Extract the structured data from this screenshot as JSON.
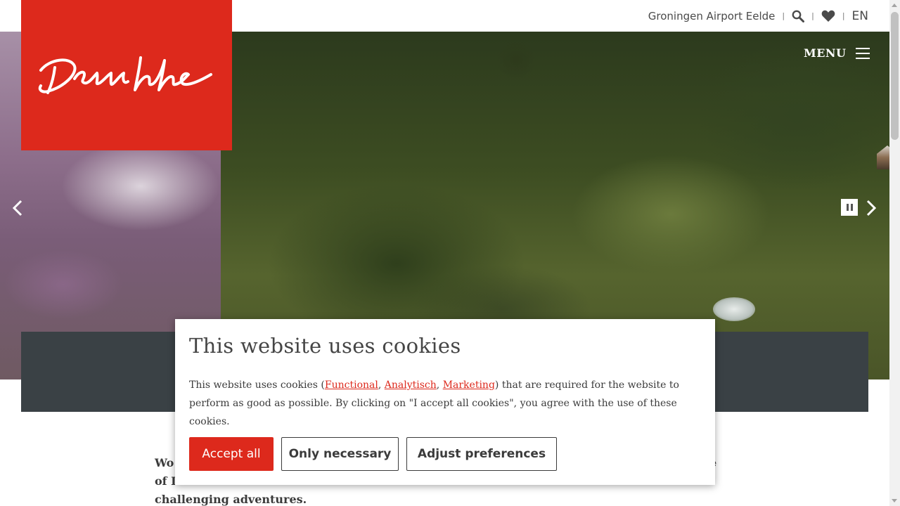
{
  "header": {
    "airport_link": "Groningen Airport Eelde",
    "language": "EN",
    "separator": "|"
  },
  "logo": {
    "text": "Drenthe",
    "color": "#dd291c"
  },
  "menu": {
    "label": "MENU"
  },
  "icons": {
    "search": "search-icon",
    "favorites": "heart-icon",
    "menu": "hamburger-icon",
    "prev": "chevron-left-icon",
    "next": "chevron-right-icon",
    "pause": "pause-icon"
  },
  "intro": {
    "line1_start": "Wo",
    "line1_end": "e",
    "line2_start": "of D",
    "line3": "challenging adventures."
  },
  "cookie": {
    "title": "This website uses cookies",
    "text_before": "This website uses cookies (",
    "link_functional": "Functional",
    "comma1": ", ",
    "link_analytics": "Analytisch",
    "comma2": ", ",
    "link_marketing": "Marketing",
    "text_after": ") that are required for the website to perform as good as possible. By clicking on \"I accept all cookies\", you agree with the use of these cookies.",
    "accept_label": "Accept all",
    "necessary_label": "Only necessary",
    "adjust_label": "Adjust preferences"
  },
  "colors": {
    "accent": "#dd291c",
    "dark_band": "#3a4145",
    "text": "#3b3b3b"
  }
}
